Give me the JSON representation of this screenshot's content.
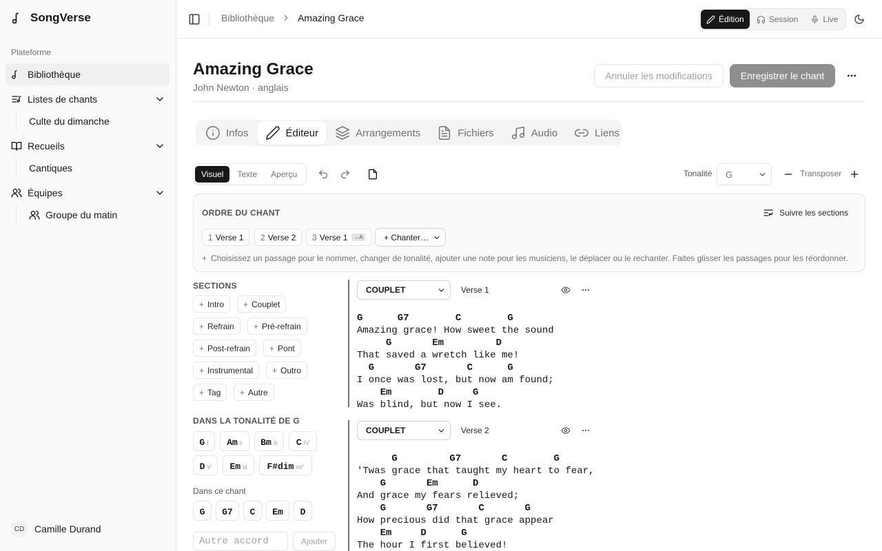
{
  "app": {
    "name": "SongVerse"
  },
  "sidebar": {
    "section_label": "Plateforme",
    "items": [
      {
        "label": "Bibliothèque",
        "icon": "music-note-icon"
      },
      {
        "label": "Listes de chants",
        "icon": "list-music-icon",
        "children": [
          "Culte du dimanche"
        ]
      },
      {
        "label": "Recueils",
        "icon": "book-open-icon",
        "children": [
          "Cantiques"
        ]
      },
      {
        "label": "Équipes",
        "icon": "users-icon",
        "children": [
          "Groupe du matin"
        ]
      }
    ],
    "user": {
      "initials": "CD",
      "name": "Camille Durand"
    }
  },
  "topbar": {
    "breadcrumb": [
      "Bibliothèque",
      "Amazing Grace"
    ],
    "modes": [
      "Édition",
      "Session",
      "Live"
    ]
  },
  "song": {
    "title": "Amazing Grace",
    "subtitle": "John Newton · anglais",
    "cancel_label": "Annuler les modifications",
    "save_label": "Enregistrer le chant"
  },
  "tabs": [
    "Infos",
    "Éditeur",
    "Arrangements",
    "Fichiers",
    "Audio",
    "Liens"
  ],
  "editor": {
    "views": [
      "Visuel",
      "Texte",
      "Aperçu"
    ],
    "key_label": "Tonalité",
    "key_value": "G",
    "transpose_label": "Transposer"
  },
  "order": {
    "title": "ORDRE DU CHANT",
    "follow_label": "Suivre les sections",
    "chips": [
      {
        "num": "1",
        "label": "Verse 1"
      },
      {
        "num": "2",
        "label": "Verse 2"
      },
      {
        "num": "3",
        "label": "Verse 1",
        "badge": "→A"
      }
    ],
    "chant_label": "+ Chanter…",
    "hint": "Choisissez un passage pour le nommer, changer de tonalité, ajouter une note pour les musiciens, le déplacer ou le rechanter. Faites glisser les passages pour les réordonner."
  },
  "palette": {
    "sections_title": "SECTIONS",
    "section_buttons": [
      "Intro",
      "Couplet",
      "Refrain",
      "Pré-refrain",
      "Post-refrain",
      "Pont",
      "Instrumental",
      "Outro",
      "Tag",
      "Autre"
    ],
    "key_title": "DANS LA TONALITÉ DE G",
    "key_chords": [
      {
        "chord": "G",
        "degree": "I"
      },
      {
        "chord": "Am",
        "degree": "ii"
      },
      {
        "chord": "Bm",
        "degree": "iii"
      },
      {
        "chord": "C",
        "degree": "IV"
      },
      {
        "chord": "D",
        "degree": "V"
      },
      {
        "chord": "Em",
        "degree": "vi"
      },
      {
        "chord": "F#dim",
        "degree": "vii°"
      }
    ],
    "song_chords_title": "Dans ce chant",
    "song_chords": [
      "G",
      "G7",
      "C",
      "Em",
      "D"
    ],
    "other_placeholder": "Autre accord",
    "add_label": "Ajouter"
  },
  "sections": [
    {
      "type": "COUPLET",
      "name": "Verse 1",
      "lines": [
        {
          "chords": "G      G7        C        G",
          "text": "Amazing grace! How sweet the sound"
        },
        {
          "chords": "     G       Em         D",
          "text": "That saved a wretch like me!"
        },
        {
          "chords": "  G       G7       C      G",
          "text": "I once was lost, but now am found;"
        },
        {
          "chords": "    Em        D     G",
          "text": "Was blind, but now I see."
        }
      ]
    },
    {
      "type": "COUPLET",
      "name": "Verse 2",
      "lines": [
        {
          "chords": "      G         G7       C        G",
          "text": "'Twas grace that taught my heart to fear,"
        },
        {
          "chords": "    G       Em      D",
          "text": "And grace my fears relieved;"
        },
        {
          "chords": "    G       G7       C       G",
          "text": "How precious did that grace appear"
        },
        {
          "chords": "    Em     D      G",
          "text": "The hour I first believed!"
        }
      ]
    }
  ]
}
